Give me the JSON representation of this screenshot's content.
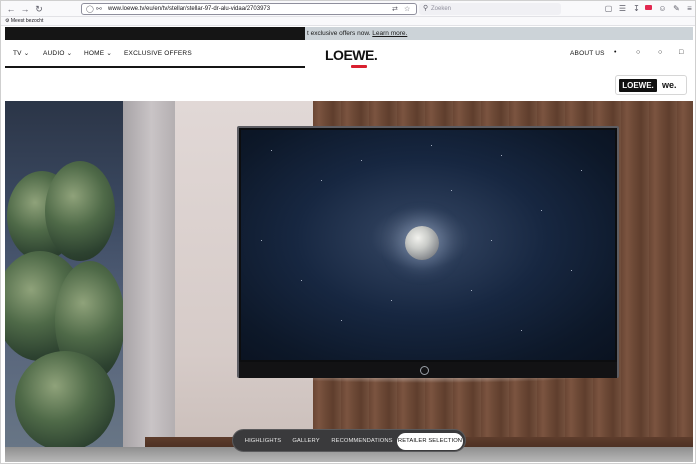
{
  "browser": {
    "url": "www.loewe.tv/eu/en/tv/stellar/stellar-97-dr-alu-vidaa/2703973",
    "search_placeholder": "Zoeken",
    "bookmark_label": "Meest bezocht"
  },
  "promo": {
    "text": "t exclusive offers now.",
    "link": "Learn more."
  },
  "header": {
    "nav": [
      {
        "label": "TV"
      },
      {
        "label": "AUDIO"
      },
      {
        "label": "HOME"
      },
      {
        "label": "EXCLUSIVE OFFERS"
      }
    ],
    "logo": "LOEWE.",
    "about": "ABOUT US"
  },
  "badges": {
    "loewe": "LOEWE.",
    "we": "we."
  },
  "hero_tabs": [
    {
      "label": "HIGHLIGHTS"
    },
    {
      "label": "GALLERY"
    },
    {
      "label": "RECOMMENDATIONS"
    },
    {
      "label": "RETAILER SELECTION"
    }
  ]
}
